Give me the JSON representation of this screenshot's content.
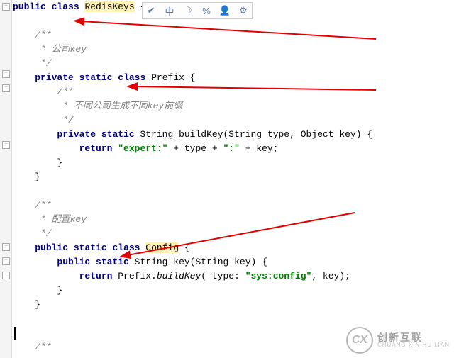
{
  "toolbar": {
    "icons": [
      "check-icon",
      "center-icon",
      "moon-icon",
      "percent-icon",
      "person-icon",
      "gear-icon"
    ]
  },
  "code": {
    "l1_kw_public": "public",
    "l1_kw_class": "class",
    "l1_name": "RedisKeys",
    "l1_br": " {",
    "l3": "/**",
    "l4": " * 公司key",
    "l5": " */",
    "l6_kw_private": "private",
    "l6_kw_static": "static",
    "l6_kw_class": "class",
    "l6_name": "Prefix",
    "l6_br": " {",
    "l7": "/**",
    "l8": " * 不同公司生成不同key前缀",
    "l9": " */",
    "l10_kw_private": "private",
    "l10_kw_static": "static",
    "l10_type": " String ",
    "l10_sig": "buildKey(String type, Object key) {",
    "l11_kw_return": "return",
    "l11_s1": "\"expert:\"",
    "l11_p1": " + type + ",
    "l11_s2": "\":\"",
    "l11_p2": " + key;",
    "l12": "}",
    "l13": "}",
    "l15": "/**",
    "l16": " * 配置key",
    "l17": " */",
    "l18_kw_public": "public",
    "l18_kw_static": "static",
    "l18_kw_class": "class",
    "l18_name": "Config",
    "l18_br": " {",
    "l19_kw_public": "public",
    "l19_kw_static": "static",
    "l19_type": " String ",
    "l19_sig": "key(String key) {",
    "l20_kw_return": "return",
    "l20_pre": " Prefix.",
    "l20_m": "buildKey",
    "l20_par": "( type: ",
    "l20_s": "\"sys:config\"",
    "l20_post": ", key);",
    "l21": "}",
    "l22": "}",
    "l24": "/**"
  },
  "watermark": {
    "logo": "CX",
    "cn": "创新互联",
    "en": "CHUANG XIN HU LIAN"
  }
}
